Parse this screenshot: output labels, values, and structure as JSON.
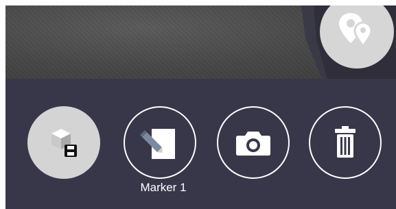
{
  "toolbar": {
    "marker_label": "Marker 1"
  },
  "icons": {
    "map": "map-pins-icon",
    "save_model": "save-3d-model-icon",
    "edit": "edit-note-icon",
    "camera": "camera-icon",
    "delete": "trash-icon"
  },
  "colors": {
    "toolbar_bg": "#38374a",
    "viewport_bg": "#474747",
    "button_fill": "#d4d4d4",
    "outline": "#ffffff"
  }
}
